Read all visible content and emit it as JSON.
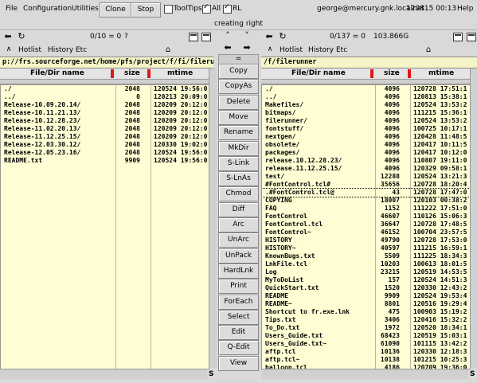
{
  "menu": [
    "File",
    "Configuration",
    "Utilities"
  ],
  "buttons": {
    "clone": "Clone",
    "stop": "Stop"
  },
  "checks": [
    {
      "label": "ToolTips",
      "checked": false
    },
    {
      "label": "All",
      "checked": true
    },
    {
      "label": "RL",
      "checked": true
    }
  ],
  "user_host": "george@mercury.gnk.localnet",
  "clock": "120815 00:13",
  "help": "Help",
  "status_text": "creating right",
  "left": {
    "count": "0/10 = 0",
    "extra": "?",
    "menu": [
      "Hotlist",
      "History",
      "Etc"
    ],
    "path": "p://frs.sourceforge.net/home/pfs/project/f/fi/filerunner",
    "headers": {
      "name": "File/Dir name",
      "size": "size",
      "mtime": "mtime"
    },
    "rows": [
      [
        "./",
        "2048",
        "120524 19:56:0"
      ],
      [
        "../",
        "0",
        "120213 20:09:0"
      ],
      [
        "Release-10.09.20.14/",
        "2048",
        "120209 20:12:0"
      ],
      [
        "Release-10.11.21.13/",
        "2048",
        "120209 20:12:0"
      ],
      [
        "Release-10.12.28.23/",
        "2048",
        "120209 20:12:0"
      ],
      [
        "Release-11.02.20.13/",
        "2048",
        "120209 20:12:0"
      ],
      [
        "Release-11.12.25.15/",
        "2048",
        "120209 20:12:0"
      ],
      [
        "Release-12.03.30.12/",
        "2048",
        "120330 19:02:0"
      ],
      [
        "Release-12.05.23.16/",
        "2048",
        "120524 19:56:0"
      ],
      [
        "README.txt",
        "9909",
        "120524 19:56:0"
      ]
    ]
  },
  "right": {
    "count": "0/137 = 0",
    "extra": "103.866G",
    "menu": [
      "Hotlist",
      "History",
      "Etc"
    ],
    "path": "/f/filerunner",
    "headers": {
      "name": "File/Dir name",
      "size": "size",
      "mtime": "mtime"
    },
    "rows": [
      [
        "./",
        "4096",
        "120728 17:51:1"
      ],
      [
        "../",
        "4096",
        "120813 15:38:1"
      ],
      [
        "Makefiles/",
        "4096",
        "120524 13:53:2"
      ],
      [
        "bitmaps/",
        "4096",
        "111215 15:36:1"
      ],
      [
        "filerunner/",
        "4096",
        "120524 13:53:2"
      ],
      [
        "fontstuff/",
        "4096",
        "100725 10:17:1"
      ],
      [
        "nextgen/",
        "4096",
        "120428 11:48:5"
      ],
      [
        "obsolete/",
        "4096",
        "120417 10:11:5"
      ],
      [
        "packages/",
        "4096",
        "120417 10:12:0"
      ],
      [
        "release.10.12.28.23/",
        "4096",
        "110807 19:11:0"
      ],
      [
        "release.11.12.25.15/",
        "4096",
        "120329 09:58:1"
      ],
      [
        "test/",
        "12288",
        "120524 13:21:3"
      ],
      [
        "#FontControl.tcl#",
        "35656",
        "120728 18:20:4"
      ],
      [
        ".#FontControl.tcl@",
        "43",
        "120728 17:47:0"
      ],
      [
        "COPYING",
        "18007",
        "120103 00:38:2"
      ],
      [
        "FAQ",
        "1152",
        "111222 17:51:0"
      ],
      [
        "FontControl",
        "46607",
        "110126 15:06:3"
      ],
      [
        "FontControl.tcl",
        "36647",
        "120728 17:48:5"
      ],
      [
        "FontControl~",
        "46152",
        "100704 23:57:5"
      ],
      [
        "HISTORY",
        "49790",
        "120728 17:53:0"
      ],
      [
        "HISTORY~",
        "40597",
        "111215 16:59:1"
      ],
      [
        "KnownBugs.txt",
        "5509",
        "111225 18:34:3"
      ],
      [
        "LnkFile.tcl",
        "10203",
        "100613 18:01:5"
      ],
      [
        "Log",
        "23215",
        "120519 14:53:5"
      ],
      [
        "MyToDoList",
        "157",
        "120524 14:51:3"
      ],
      [
        "QuickStart.txt",
        "1520",
        "120330 12:43:2"
      ],
      [
        "README",
        "9909",
        "120524 19:53:4"
      ],
      [
        "README~",
        "8801",
        "120516 19:29:4"
      ],
      [
        "Shortcut to fr.exe.lnk",
        "475",
        "100903 15:19:2"
      ],
      [
        "Tips.txt",
        "3406",
        "120416 15:32:2"
      ],
      [
        "To_Do.txt",
        "1972",
        "120520 18:34:1"
      ],
      [
        "Users_Guide.txt",
        "68423",
        "120519 15:03:1"
      ],
      [
        "Users_Guide.txt~",
        "61090",
        "101115 13:42:2"
      ],
      [
        "aftp.tcl",
        "10136",
        "120330 12:18:3"
      ],
      [
        "aftp.tcl~",
        "10138",
        "101215 10:25:3"
      ],
      [
        "balloon.tcl",
        "4186",
        "120709 19:36:0"
      ]
    ]
  },
  "middle": {
    "eq": "=",
    "commands": [
      "Copy",
      "CopyAs",
      "Delete",
      "Move",
      "Rename",
      "MkDir",
      "S-Link",
      "S-LnAs",
      "Chmod",
      "Diff",
      "Arc",
      "UnArc",
      "UnPack",
      "HardLnk",
      "Print",
      "ForEach",
      "Select",
      "Edit",
      "Q-Edit",
      "View"
    ]
  },
  "scroll_s": "S"
}
